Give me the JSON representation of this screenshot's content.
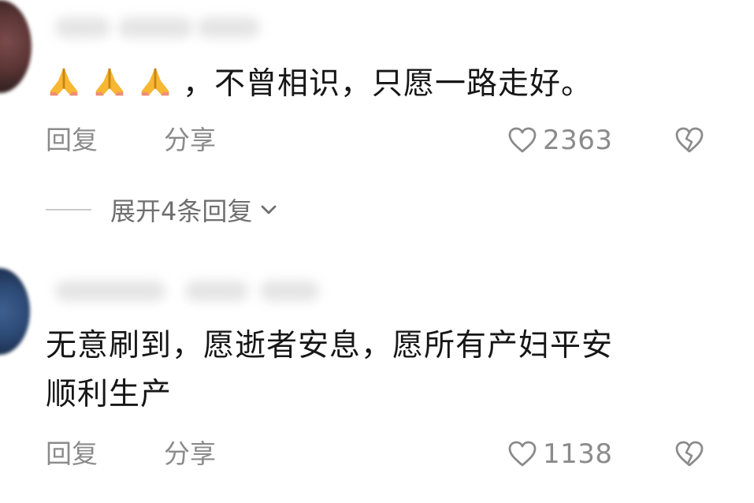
{
  "comments": [
    {
      "emoji_count": 3,
      "emoji": "pray-emoji",
      "text": "，不曾相识，只愿一路走好。",
      "reply_label": "回复",
      "share_label": "分享",
      "likes": "2363",
      "replies_expand_label": "展开4条回复"
    },
    {
      "text_line1": "无意刷到，愿逝者安息，愿所有产妇平安",
      "text_line2": "顺利生产",
      "reply_label": "回复",
      "share_label": "分享",
      "likes": "1138"
    }
  ],
  "icons": {
    "like": "heart-outline-icon",
    "dislike": "broken-heart-icon",
    "expand": "chevron-down-icon"
  },
  "colors": {
    "text": "#161616",
    "muted": "#8b8b8b",
    "emoji": "#f7b733"
  }
}
